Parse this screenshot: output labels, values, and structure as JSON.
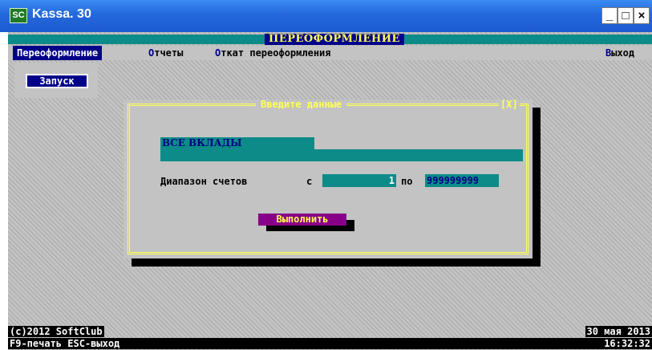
{
  "window": {
    "title": "Kassa. 30",
    "icon_text": "SC",
    "minimize_glyph": "_",
    "maximize_glyph": "□",
    "close_glyph": "×"
  },
  "screen": {
    "title": "ПЕРЕОФОРМЛЕНИЕ"
  },
  "menu": {
    "items": [
      {
        "hot": "П",
        "rest": "ереоформление"
      },
      {
        "hot": "О",
        "rest": "тчеты"
      },
      {
        "hot": "О",
        "rest": "ткат переоформления"
      },
      {
        "hot": "В",
        "rest": "ыход"
      }
    ]
  },
  "run_button": "Запуск",
  "dialog": {
    "title": "Введите данные",
    "close_label": "[X]",
    "deposits_value": "ВСЕ ВКЛАДЫ",
    "range_label": "Диапазон счетов",
    "from_label": "с",
    "from_value": "1",
    "to_label": "по",
    "to_value": "999999999",
    "execute_label": "Выполнить"
  },
  "status": {
    "copyright": "(c)2012 SoftClub",
    "date": "30 мая 2013",
    "hotkeys": "F9-печать ESC-выход",
    "time": "16:32:32"
  },
  "colors": {
    "background": "#c3c3c3",
    "accent_teal": "#0d8b88",
    "selection_blue": "#000088",
    "highlight_yellow": "#ffff55",
    "button_magenta": "#880088"
  }
}
